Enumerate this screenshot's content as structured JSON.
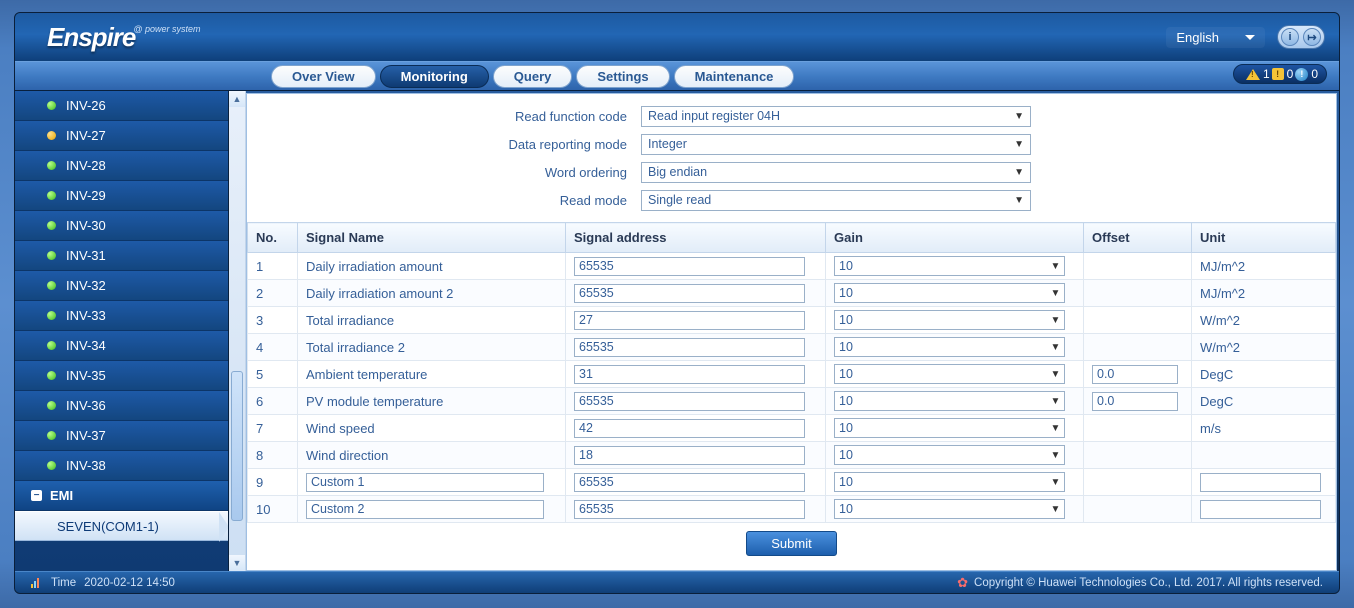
{
  "header": {
    "logo_main": "Enspire",
    "logo_sub": "@ power system",
    "language": "English"
  },
  "tabs": {
    "overview": "Over View",
    "monitoring": "Monitoring",
    "query": "Query",
    "settings": "Settings",
    "maintenance": "Maintenance"
  },
  "alarms": {
    "critical": "1",
    "major": "0",
    "minor": "0"
  },
  "sidebar": {
    "items": [
      {
        "label": "INV-26",
        "status": "green"
      },
      {
        "label": "INV-27",
        "status": "orange"
      },
      {
        "label": "INV-28",
        "status": "green"
      },
      {
        "label": "INV-29",
        "status": "green"
      },
      {
        "label": "INV-30",
        "status": "green"
      },
      {
        "label": "INV-31",
        "status": "green"
      },
      {
        "label": "INV-32",
        "status": "green"
      },
      {
        "label": "INV-33",
        "status": "green"
      },
      {
        "label": "INV-34",
        "status": "green"
      },
      {
        "label": "INV-35",
        "status": "green"
      },
      {
        "label": "INV-36",
        "status": "green"
      },
      {
        "label": "INV-37",
        "status": "green"
      },
      {
        "label": "INV-38",
        "status": "green"
      }
    ],
    "parent": "EMI",
    "active": "SEVEN(COM1-1)"
  },
  "form": {
    "read_function_code": {
      "label": "Read function code",
      "value": "Read input register 04H"
    },
    "data_reporting_mode": {
      "label": "Data reporting mode",
      "value": "Integer"
    },
    "word_ordering": {
      "label": "Word ordering",
      "value": "Big endian"
    },
    "read_mode": {
      "label": "Read mode",
      "value": "Single read"
    }
  },
  "table": {
    "headers": {
      "no": "No.",
      "signal_name": "Signal Name",
      "signal_address": "Signal address",
      "gain": "Gain",
      "offset": "Offset",
      "unit": "Unit"
    },
    "rows": [
      {
        "no": "1",
        "name": "Daily irradiation amount",
        "name_editable": false,
        "addr": "65535",
        "gain": "10",
        "offset": "",
        "offset_editable": false,
        "unit": "MJ/m^2",
        "unit_editable": false
      },
      {
        "no": "2",
        "name": "Daily irradiation amount 2",
        "name_editable": false,
        "addr": "65535",
        "gain": "10",
        "offset": "",
        "offset_editable": false,
        "unit": "MJ/m^2",
        "unit_editable": false
      },
      {
        "no": "3",
        "name": "Total irradiance",
        "name_editable": false,
        "addr": "27",
        "gain": "10",
        "offset": "",
        "offset_editable": false,
        "unit": "W/m^2",
        "unit_editable": false
      },
      {
        "no": "4",
        "name": "Total irradiance 2",
        "name_editable": false,
        "addr": "65535",
        "gain": "10",
        "offset": "",
        "offset_editable": false,
        "unit": "W/m^2",
        "unit_editable": false
      },
      {
        "no": "5",
        "name": "Ambient temperature",
        "name_editable": false,
        "addr": "31",
        "gain": "10",
        "offset": "0.0",
        "offset_editable": true,
        "unit": "DegC",
        "unit_editable": false
      },
      {
        "no": "6",
        "name": "PV module temperature",
        "name_editable": false,
        "addr": "65535",
        "gain": "10",
        "offset": "0.0",
        "offset_editable": true,
        "unit": "DegC",
        "unit_editable": false
      },
      {
        "no": "7",
        "name": "Wind speed",
        "name_editable": false,
        "addr": "42",
        "gain": "10",
        "offset": "",
        "offset_editable": false,
        "unit": "m/s",
        "unit_editable": false
      },
      {
        "no": "8",
        "name": "Wind direction",
        "name_editable": false,
        "addr": "18",
        "gain": "10",
        "offset": "",
        "offset_editable": false,
        "unit": "",
        "unit_editable": false
      },
      {
        "no": "9",
        "name": "Custom 1",
        "name_editable": true,
        "addr": "65535",
        "gain": "10",
        "offset": "",
        "offset_editable": false,
        "unit": "",
        "unit_editable": true
      },
      {
        "no": "10",
        "name": "Custom 2",
        "name_editable": true,
        "addr": "65535",
        "gain": "10",
        "offset": "",
        "offset_editable": false,
        "unit": "",
        "unit_editable": true
      }
    ]
  },
  "buttons": {
    "submit": "Submit"
  },
  "footer": {
    "time_label": "Time",
    "time_value": "2020-02-12 14:50",
    "copyright": "Copyright © Huawei Technologies Co., Ltd. 2017. All rights reserved."
  }
}
